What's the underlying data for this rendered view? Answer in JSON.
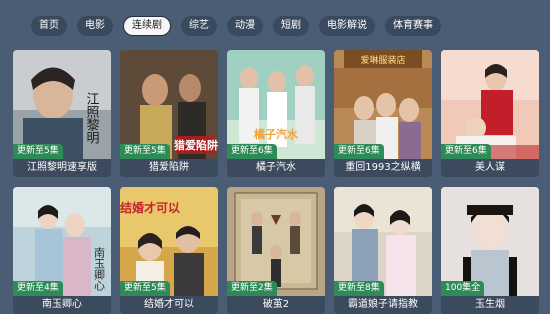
{
  "tabs": [
    {
      "label": "首页",
      "active": false
    },
    {
      "label": "电影",
      "active": false
    },
    {
      "label": "连续剧",
      "active": true
    },
    {
      "label": "综艺",
      "active": false
    },
    {
      "label": "动漫",
      "active": false
    },
    {
      "label": "短剧",
      "active": false
    },
    {
      "label": "电影解说",
      "active": false
    },
    {
      "label": "体育赛事",
      "active": false
    }
  ],
  "cards": [
    {
      "title": "江照黎明速享版",
      "badge": "更新至5集",
      "poster_text": "江照黎明"
    },
    {
      "title": "猎爱陷阱",
      "badge": "更新至5集",
      "poster_text": "猎爱陷阱"
    },
    {
      "title": "橘子汽水",
      "badge": "更新至6集",
      "poster_text": "橘子汽水"
    },
    {
      "title": "重回1993之纵横",
      "badge": "更新至6集",
      "poster_text": "爱琳服装店"
    },
    {
      "title": "美人谋",
      "badge": "更新至6集",
      "poster_text": ""
    },
    {
      "title": "南玉卿心",
      "badge": "更新至4集",
      "poster_text": "南玉卿心"
    },
    {
      "title": "结婚才可以",
      "badge": "更新至5集",
      "poster_text": "结婚才可以"
    },
    {
      "title": "破茧2",
      "badge": "更新至2集",
      "poster_text": ""
    },
    {
      "title": "霸道娘子请指教",
      "badge": "更新至8集",
      "poster_text": ""
    },
    {
      "title": "玉生烟",
      "badge": "100集全",
      "poster_text": ""
    }
  ]
}
